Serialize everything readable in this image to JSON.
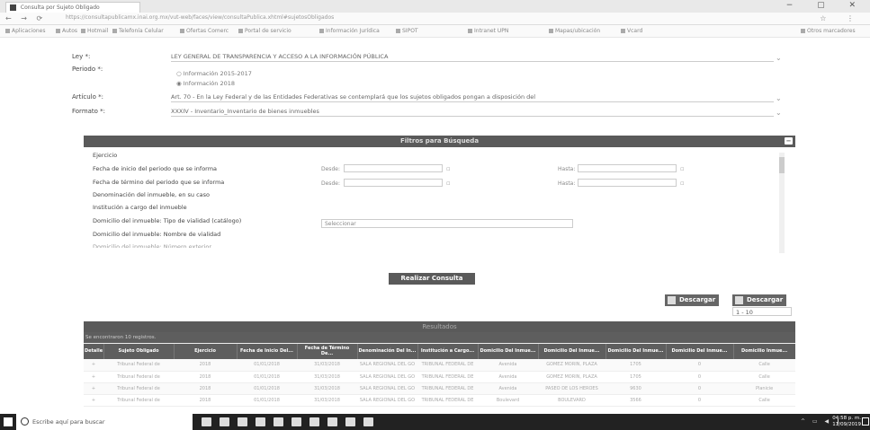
{
  "browser": {
    "tab_title": "Consulta por Sujeto Obligado",
    "url": "https://consultapublicamx.inai.org.mx/vut-web/faces/view/consultaPublica.xhtml#sujetosObligados",
    "bookmarks": [
      "Aplicaciones",
      "Autos",
      "Hotmail",
      "Telefonía Celular",
      "Ofertas Comerc",
      "Portal de servicio",
      "Información Jurídica",
      "SIPOT",
      "Intranet UPN",
      "Mapas/ubicación",
      "Vcard",
      "Otros marcadores"
    ]
  },
  "form": {
    "ley_label": "Ley *:",
    "ley_value": "LEY GENERAL DE TRANSPARENCIA Y ACCESO A LA INFORMACIÓN PÚBLICA",
    "periodo_label": "Periodo *:",
    "periodo_opt1": "Información 2015-2017",
    "periodo_opt2": "Información 2018",
    "articulo_label": "Artículo *:",
    "articulo_value": "Art. 70 - En la Ley Federal y de las Entidades Federativas se contemplará que los sujetos obligados pongan a disposición del",
    "formato_label": "Formato *:",
    "formato_value": "XXXIV - Inventario_Inventario de bienes inmuebles"
  },
  "filters": {
    "header": "Filtros para Búsqueda",
    "collapse_symbol": "−",
    "fields": [
      "Ejercicio",
      "Fecha de inicio del periodo que se informa",
      "Fecha de término del periodo que se informa",
      "Denominación del inmueble, en su caso",
      "Institución a cargo del inmueble",
      "Domicilio del inmueble: Tipo de vialidad (catálogo)",
      "Domicilio del inmueble: Nombre de vialidad",
      "Domicilio del inmueble: Número exterior"
    ],
    "desde": "Desde:",
    "hasta": "Hasta:",
    "select_placeholder": "Seleccionar"
  },
  "actions": {
    "consulta": "Realizar Consulta",
    "descargar1": "Descargar",
    "descargar2": "Descargar",
    "page_select": "1 - 10"
  },
  "results": {
    "header": "Resultados",
    "count_text": "Se encontraron 10 registros.",
    "columns": [
      "Detalle",
      "Sujeto Obligado",
      "Ejercicio",
      "Fecha de Inicio Del...",
      "Fecha de Término De...",
      "Denominación Del In...",
      "Institución a Cargo...",
      "Domicilio Del Inmue...",
      "Domicilio Del Inmue...",
      "Domicilio Del Inmue...",
      "Domicilio Del Inmue...",
      "Domicilio Inmue..."
    ],
    "rows": [
      [
        "+",
        "Tribunal Federal de",
        "2018",
        "01/01/2018",
        "31/03/2018",
        "SALA REGIONAL DEL GO",
        "TRIBUNAL FEDERAL DE",
        "Avenida",
        "GOMEZ MORIN, PLAZA",
        "1705",
        "0",
        "Calle"
      ],
      [
        "+",
        "Tribunal Federal de",
        "2018",
        "01/01/2018",
        "31/03/2018",
        "SALA REGIONAL DEL GO",
        "TRIBUNAL FEDERAL DE",
        "Avenida",
        "GOMEZ MORIN, PLAZA",
        "1705",
        "0",
        "Calle"
      ],
      [
        "+",
        "Tribunal Federal de",
        "2018",
        "01/01/2018",
        "31/03/2018",
        "SALA REGIONAL DEL GO",
        "TRIBUNAL FEDERAL DE",
        "Avenida",
        "PASEO DE LOS HEROES",
        "9630",
        "0",
        "Planicie"
      ],
      [
        "+",
        "Tribunal Federal de",
        "2018",
        "01/01/2018",
        "31/03/2018",
        "SALA REGIONAL DEL GO",
        "TRIBUNAL FEDERAL DE",
        "Boulevard",
        "BOULEVARD",
        "3566",
        "0",
        "Calle"
      ]
    ]
  },
  "taskbar": {
    "search_placeholder": "Escribe aquí para buscar",
    "time": "04:58 p. m.",
    "date": "11/09/2019"
  }
}
